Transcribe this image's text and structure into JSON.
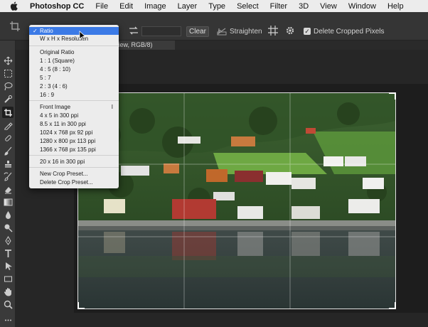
{
  "menubar": {
    "app_name": "Photoshop CC",
    "items": [
      "File",
      "Edit",
      "Image",
      "Layer",
      "Type",
      "Select",
      "Filter",
      "3D",
      "View",
      "Window",
      "Help"
    ]
  },
  "traffic_lights": {
    "close": "#fe5f57",
    "minimize": "#febb2e",
    "zoom": "#28c840"
  },
  "options_bar": {
    "clear_label": "Clear",
    "straighten_label": "Straighten",
    "delete_cropped_label": "Delete Cropped Pixels",
    "delete_cropped_checked": true
  },
  "document_tab": {
    "label": "view, RGB/8)"
  },
  "crop_menu": {
    "items": [
      {
        "label": "Ratio",
        "checked": true
      },
      {
        "label": "W x H x Resolution",
        "checked": false
      },
      {
        "label": "Original Ratio"
      },
      {
        "label": "1 : 1 (Square)"
      },
      {
        "label": "4 : 5 (8 : 10)"
      },
      {
        "label": "5 : 7"
      },
      {
        "label": "2 : 3 (4 : 6)"
      },
      {
        "label": "16 : 9"
      },
      {
        "label": "Front Image",
        "trailing": "I"
      },
      {
        "label": "4 x 5 in 300 ppi"
      },
      {
        "label": "8.5 x 11 in 300 ppi"
      },
      {
        "label": "1024 x 768 px 92 ppi"
      },
      {
        "label": "1280 x 800 px 113 ppi"
      },
      {
        "label": "1366 x 768 px 135 ppi"
      },
      {
        "label": "20 x 16 in 300 ppi"
      },
      {
        "label": "New Crop Preset..."
      },
      {
        "label": "Delete Crop Preset..."
      }
    ]
  },
  "colors": {
    "accent": "#3b7ae6",
    "panel": "#353535",
    "workspace": "#262626"
  }
}
